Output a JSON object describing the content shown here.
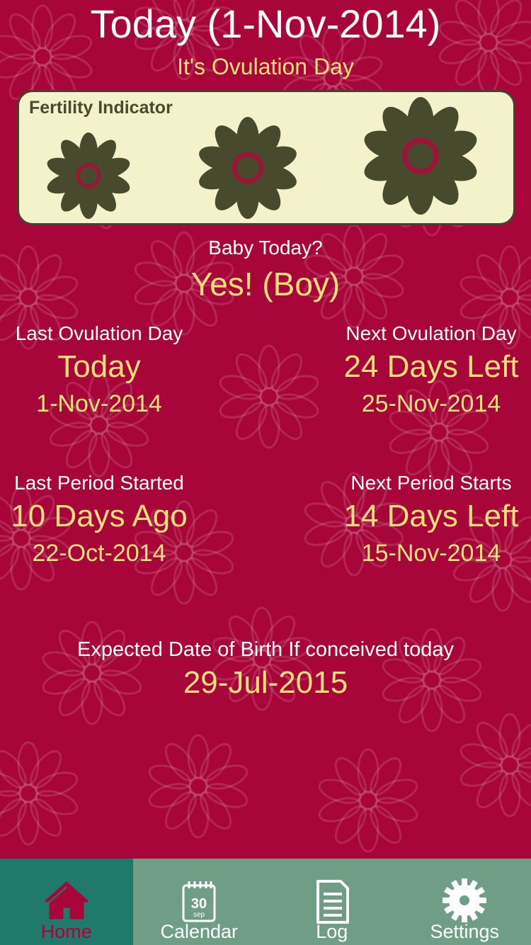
{
  "header": {
    "title": "Today (1-Nov-2014)",
    "status": "It's Ovulation Day"
  },
  "fertility": {
    "label": "Fertility Indicator",
    "flower_icon": "daisy-icon",
    "flower_color": "#474a2c",
    "center_color": "#9b1538"
  },
  "baby": {
    "question": "Baby Today?",
    "answer": "Yes! (Boy)"
  },
  "last_ovulation": {
    "label": "Last Ovulation Day",
    "value": "Today",
    "date": "1-Nov-2014"
  },
  "next_ovulation": {
    "label": "Next Ovulation Day",
    "value": "24 Days Left",
    "date": "25-Nov-2014"
  },
  "last_period": {
    "label": "Last Period Started",
    "value": "10 Days Ago",
    "date": "22-Oct-2014"
  },
  "next_period": {
    "label": "Next Period Starts",
    "value": "14 Days Left",
    "date": "15-Nov-2014"
  },
  "birth": {
    "label": "Expected Date of Birth If conceived today",
    "date": "29-Jul-2015"
  },
  "tabs": [
    {
      "label": "Home",
      "icon": "home-icon",
      "active": true
    },
    {
      "label": "Calendar",
      "icon": "calendar-icon",
      "active": false,
      "icon_text_day": "30",
      "icon_text_month": "sep"
    },
    {
      "label": "Log",
      "icon": "log-icon",
      "active": false
    },
    {
      "label": "Settings",
      "icon": "gear-icon",
      "active": false
    }
  ],
  "colors": {
    "background": "#a8063a",
    "accent_yellow": "#f6e07a",
    "tabbar": "#6f9d86",
    "tab_active": "#207a6c"
  }
}
